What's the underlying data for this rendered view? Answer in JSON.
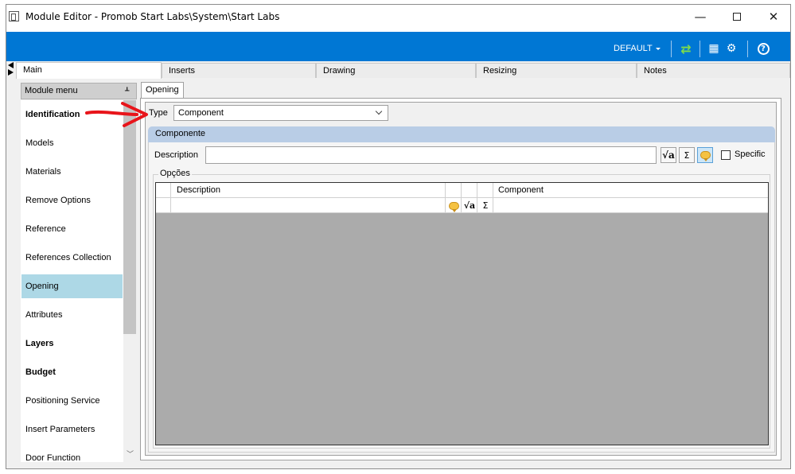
{
  "window": {
    "title": "Module Editor - Promob Start Labs\\System\\Start Labs",
    "minimize_glyph": "—",
    "close_glyph": "✕"
  },
  "toolbar": {
    "profile": "DEFAULT",
    "refresh_glyph": "⇄",
    "layout_glyph": "▦",
    "settings_glyph": "⚙",
    "help_glyph": "?"
  },
  "main_tabs": [
    {
      "label": "Main",
      "active": true
    },
    {
      "label": "Inserts",
      "active": false
    },
    {
      "label": "Drawing",
      "active": false
    },
    {
      "label": "Resizing",
      "active": false
    },
    {
      "label": "Notes",
      "active": false
    }
  ],
  "module_menu": {
    "title": "Module menu",
    "pin_glyph": "ᚆ",
    "scroll_down_glyph": "﹀",
    "items": [
      {
        "label": "Identification",
        "bold": true,
        "selected": false
      },
      {
        "label": "Models",
        "bold": false,
        "selected": false
      },
      {
        "label": "Materials",
        "bold": false,
        "selected": false
      },
      {
        "label": "Remove Options",
        "bold": false,
        "selected": false
      },
      {
        "label": "Reference",
        "bold": false,
        "selected": false
      },
      {
        "label": "References Collection",
        "bold": false,
        "selected": false
      },
      {
        "label": "Opening",
        "bold": false,
        "selected": true
      },
      {
        "label": "Attributes",
        "bold": false,
        "selected": false
      },
      {
        "label": "Layers",
        "bold": true,
        "selected": false
      },
      {
        "label": "Budget",
        "bold": true,
        "selected": false
      },
      {
        "label": "Positioning Service",
        "bold": false,
        "selected": false
      },
      {
        "label": "Insert Parameters",
        "bold": false,
        "selected": false
      },
      {
        "label": "Door Function",
        "bold": false,
        "selected": false
      }
    ]
  },
  "content": {
    "subtab": "Opening",
    "type_label": "Type",
    "type_value": "Component",
    "group_title": "Componente",
    "description_label": "Description",
    "description_value": "",
    "sqrt_glyph": "√a",
    "sigma_glyph": "Σ",
    "specific_label": "Specific",
    "specific_checked": false,
    "options_label": "Opções",
    "grid": {
      "columns": [
        "Description",
        "Component"
      ],
      "rows": [
        {
          "description": "",
          "component": ""
        }
      ]
    }
  },
  "colors": {
    "toolbar_bg": "#0077d4",
    "selected_menu": "#add8e6",
    "group_header": "#b9cde6",
    "annotation_arrow": "#e8141a"
  }
}
